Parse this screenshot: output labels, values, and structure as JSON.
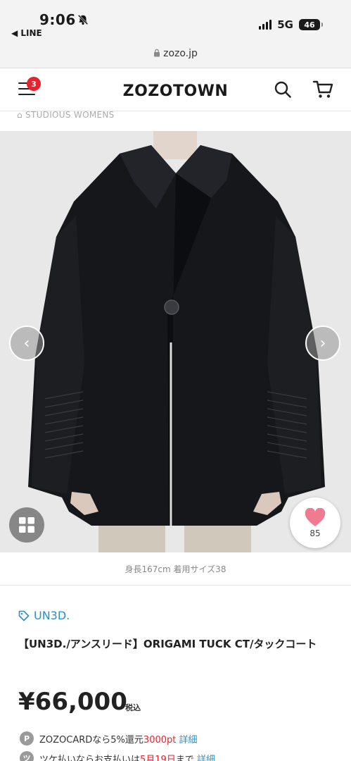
{
  "status_bar": {
    "time": "9:06",
    "back_app": "◀ LINE",
    "network": "5G",
    "battery": "46"
  },
  "url": "zozo.jp",
  "header": {
    "logo": "ZOZOTOWN",
    "menu_badge": "3"
  },
  "shop_line": "STUDIOUS WOMENS",
  "gallery": {
    "favorite_count": "85"
  },
  "model_info": "身長167cm 着用サイズ38",
  "product": {
    "brand": "UN3D.",
    "name": "【UN3D./アンスリード】ORIGAMI TUCK CT/タックコート",
    "price": "¥66,000",
    "tax_label": "税込"
  },
  "promos": [
    {
      "icon": "P",
      "text": "ZOZOCARDなら5%還元",
      "highlight": "3000pt",
      "link": "詳細"
    },
    {
      "icon": "ツ",
      "text": "ツケ払いならお支払いは",
      "highlight": "5月19日",
      "suffix": "まで",
      "link": "詳細"
    }
  ],
  "colors": {
    "accent_blue": "#2a8fc4",
    "badge_red": "#e8212c",
    "heart_pink": "#f07a8f"
  }
}
